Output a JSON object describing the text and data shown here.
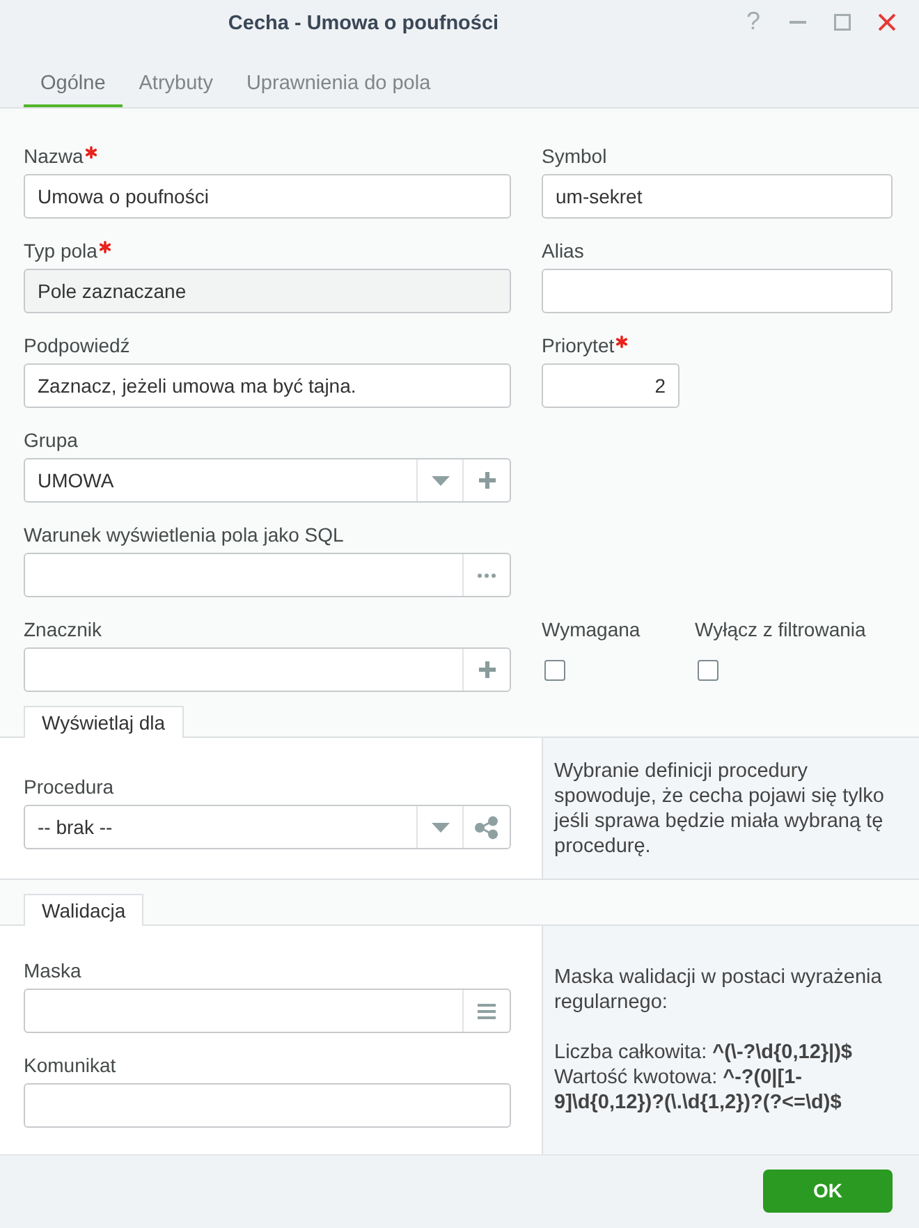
{
  "window": {
    "title": "Cecha - Umowa o poufności",
    "help": "?"
  },
  "tabs": [
    {
      "label": "Ogólne",
      "selected": true
    },
    {
      "label": "Atrybuty",
      "selected": false
    },
    {
      "label": "Uprawnienia do pola",
      "selected": false
    }
  ],
  "form": {
    "rows": [
      {
        "fields": [
          {
            "kind": "text",
            "label": "Nazwa",
            "required": true,
            "disabled": false,
            "value": "Umowa o poufności"
          },
          {
            "kind": "text",
            "label": "Symbol",
            "required": false,
            "disabled": false,
            "value": "um-sekret"
          }
        ]
      },
      {
        "fields": [
          {
            "kind": "text",
            "label": "Typ pola",
            "required": true,
            "disabled": true,
            "value": "Pole zaznaczane"
          },
          {
            "kind": "text",
            "label": "Alias",
            "required": false,
            "disabled": false
          }
        ]
      },
      {
        "fields": [
          {
            "kind": "text",
            "label": "Podpowiedź",
            "required": false,
            "disabled": false,
            "value": "Zaznacz, jeżeli umowa ma być tajna."
          },
          {
            "kind": "number",
            "label": "Priorytet",
            "required": true,
            "value": "2"
          }
        ]
      },
      {
        "fields": [
          {
            "kind": "combo",
            "label": "Grupa",
            "required": false,
            "value": "UMOWA"
          }
        ]
      },
      {
        "fields": [
          {
            "kind": "lookup",
            "label": "Warunek wyświetlenia pola jako SQL",
            "required": false
          }
        ]
      },
      {
        "fields": [
          {
            "kind": "tagger",
            "label": "Znacznik",
            "required": false
          },
          {
            "kind": "checkbox",
            "label": "Wymagana",
            "required": false,
            "checked": false
          },
          {
            "kind": "checkbox",
            "label": "Wyłącz z filtrowania",
            "required": false,
            "checked": false
          }
        ]
      }
    ]
  },
  "sections": [
    {
      "title": "Wyświetlaj dla",
      "fields": [
        {
          "kind": "linked",
          "label": "Procedura",
          "required": false,
          "value": "-- brak --"
        }
      ],
      "info": {
        "intro": "Wybranie definicji procedury spowoduje, że cecha pojawi się tylko jeśli sprawa będzie miała wybraną tę procedurę."
      }
    },
    {
      "title": "Walidacja",
      "fields": [
        {
          "kind": "pattern",
          "label": "Maska",
          "required": false
        },
        {
          "kind": "text",
          "label": "Komunikat",
          "required": false,
          "disabled": false
        }
      ],
      "info": {
        "intro": "Maska walidacji w postaci wyrażenia regularnego:",
        "examples": [
          "Liczba całkowita: **^(\\-?\\d{0,12}|)$**",
          "Wartość kwotowa: **^-?(0|[1-9]\\d{0,12})?(\\.\\d{1,2})?(?<=\\d)$**"
        ]
      }
    }
  ],
  "footer": {
    "buttons": [
      "OK"
    ]
  }
}
